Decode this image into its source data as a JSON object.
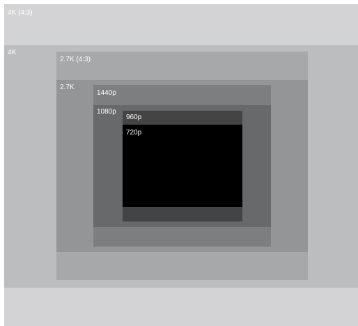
{
  "resolutions": [
    {
      "id": "r-4k43",
      "label": "4K (4:3)",
      "color": "#d3d3d5"
    },
    {
      "id": "r-4k",
      "label": "4K",
      "color": "#bcbdbf"
    },
    {
      "id": "r-27k43",
      "label": "2.7K (4:3)",
      "color": "#a7a8aa"
    },
    {
      "id": "r-27k",
      "label": "2.7K",
      "color": "#949597"
    },
    {
      "id": "r-1440p",
      "label": "1440p",
      "color": "#7d7e80"
    },
    {
      "id": "r-1080p",
      "label": "1080p",
      "color": "#68696b"
    },
    {
      "id": "r-960p",
      "label": "960p",
      "color": "#444445"
    },
    {
      "id": "r-720p",
      "label": "720p",
      "color": "#000000"
    }
  ]
}
